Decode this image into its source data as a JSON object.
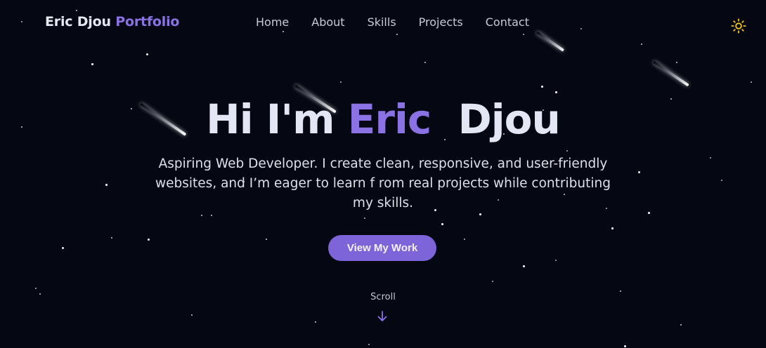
{
  "header": {
    "brand_name": "Eric Djou",
    "brand_accent": "Portfolio",
    "nav": [
      {
        "label": "Home"
      },
      {
        "label": "About"
      },
      {
        "label": "Skills"
      },
      {
        "label": "Projects"
      },
      {
        "label": "Contact"
      }
    ],
    "theme_toggle_icon": "sun-icon"
  },
  "hero": {
    "title_prefix": "Hi I'm",
    "title_accent": "Eric",
    "title_suffix": "Djou",
    "subtitle": "Aspiring Web Developer. I create clean, responsive, and user-friendly websites, and I’m eager to learn f rom real projects while contributing my skills.",
    "cta_label": "View My Work",
    "scroll_label": "Scroll",
    "scroll_icon": "arrow-down-icon"
  },
  "colors": {
    "background": "#050812",
    "accent": "#8b72e4",
    "button": "#7d64d8",
    "text": "#e3e6f4",
    "sun": "#f5c518"
  }
}
